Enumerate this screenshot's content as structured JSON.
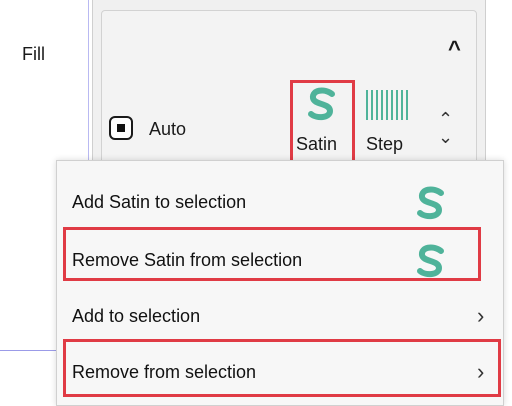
{
  "panel": {
    "fill_title": "Fill",
    "auto_label": "Auto",
    "styles": [
      {
        "name": "satin-icon",
        "label": "Satin",
        "selected": true
      },
      {
        "name": "step-icon",
        "label": "Step",
        "selected": false
      }
    ]
  },
  "menu": {
    "items": [
      {
        "label": "Add Satin to selection",
        "icon": "satin-icon",
        "submenu": false
      },
      {
        "label": "Remove Satin from selection",
        "icon": "satin-icon",
        "submenu": false
      },
      {
        "label": "Add to selection",
        "icon": "",
        "submenu": true
      },
      {
        "label": "Remove from selection",
        "icon": "",
        "submenu": true
      }
    ]
  },
  "colors": {
    "highlight": "#e03b45",
    "satin_teal": "#4fb39a"
  }
}
